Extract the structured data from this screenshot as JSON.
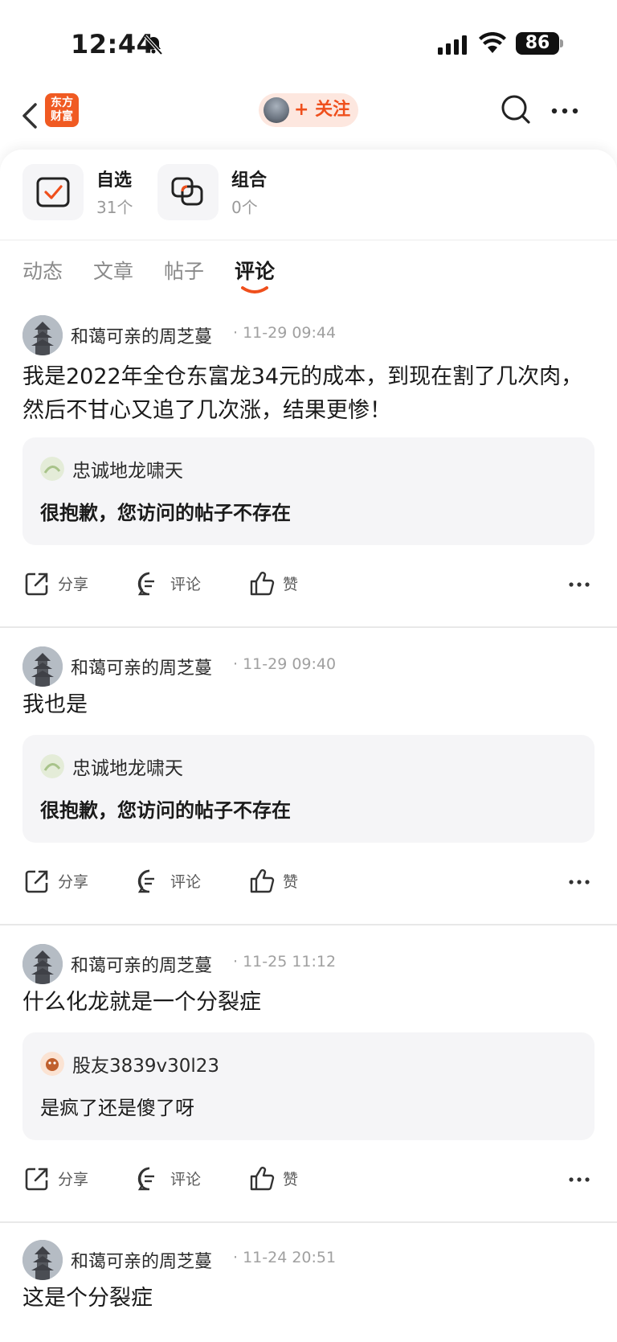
{
  "status_bar": {
    "time": "12:44",
    "battery": "86",
    "icons": [
      "bell-slash-icon",
      "cellular-signal-icon",
      "wifi-icon",
      "battery-icon"
    ]
  },
  "nav": {
    "logo_line1": "东方",
    "logo_line2": "财富",
    "follow_label": "+ 关注",
    "icons": [
      "back-chevron-icon",
      "search-icon",
      "more-icon"
    ]
  },
  "cards": [
    {
      "title": "自选",
      "count": "31个",
      "icon": "checkbox-icon"
    },
    {
      "title": "组合",
      "count": "0个",
      "icon": "portfolio-icon"
    }
  ],
  "tabs": [
    "动态",
    "文章",
    "帖子",
    "评论"
  ],
  "active_tab": "评论",
  "accent_color": "#ef4f1c",
  "posts": [
    {
      "author": "和蔼可亲的周芝蔓",
      "time": "· 11-29 09:44",
      "content": "我是2022年全仓东富龙34元的成本，到现在割了几次肉，然后不甘心又追了几次涨，结果更惨！",
      "quote": {
        "name": "忠诚地龙啸天",
        "text": "很抱歉，您访问的帖子不存在"
      }
    },
    {
      "author": "和蔼可亲的周芝蔓",
      "time": "· 11-29 09:40",
      "content": "我也是",
      "quote": {
        "name": "忠诚地龙啸天",
        "text": "很抱歉，您访问的帖子不存在"
      }
    },
    {
      "author": "和蔼可亲的周芝蔓",
      "time": "· 11-25 11:12",
      "content": "什么化龙就是一个分裂症",
      "quote": {
        "name": "股友3839v30l23",
        "text": "是疯了还是傻了呀"
      }
    },
    {
      "author": "和蔼可亲的周芝蔓",
      "time": "· 11-24 20:51",
      "content": "这是个分裂症"
    }
  ],
  "actions": {
    "share": "分享",
    "comment": "评论",
    "like": "赞"
  }
}
